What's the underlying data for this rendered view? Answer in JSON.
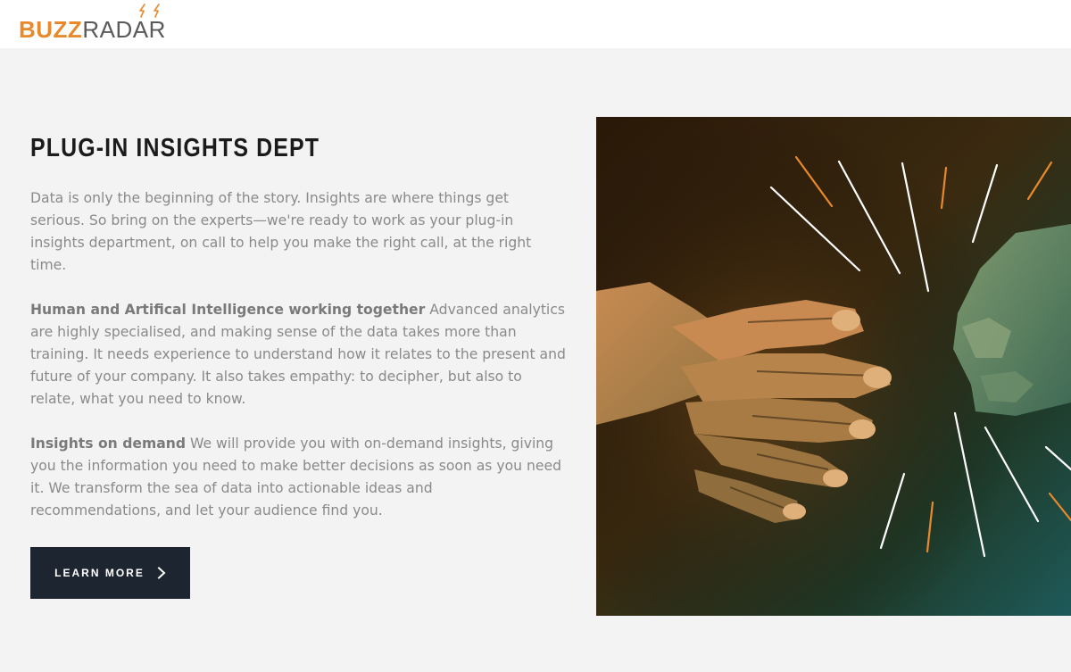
{
  "brand": {
    "name_part1": "BUZZ",
    "name_part2": "RADAR",
    "color_part1": "#e8892b",
    "color_part2": "#5a5a5a"
  },
  "section": {
    "title": "PLUG-IN INSIGHTS DEPT",
    "intro": "Data is only the beginning of the story. Insights are where things get serious. So bring on the experts—we're ready to work as your plug-in insights department, on call to help you make the right call, at the right time.",
    "block1_heading": "Human and Artifical Intelligence working together",
    "block1_text": " Advanced analytics are highly specialised, and making sense of the data takes more than training. It needs experience to understand how it relates to the present and future of your company. It also takes empathy: to decipher, but also to relate, what you need to know.",
    "block2_heading": "Insights on demand",
    "block2_text": " We will provide you with on-demand insights, giving you the information you need to make better decisions as soon as you need it. We transform the sea of data into actionable ideas and recommendations, and let your audience find you."
  },
  "cta": {
    "label": "LEARN MORE",
    "icon": "chevron-right-icon"
  },
  "hero_image": {
    "subject": "robot-hand-and-human-fist-bump",
    "accent_line_color": "#e8892b",
    "line_color": "#ffffff"
  }
}
